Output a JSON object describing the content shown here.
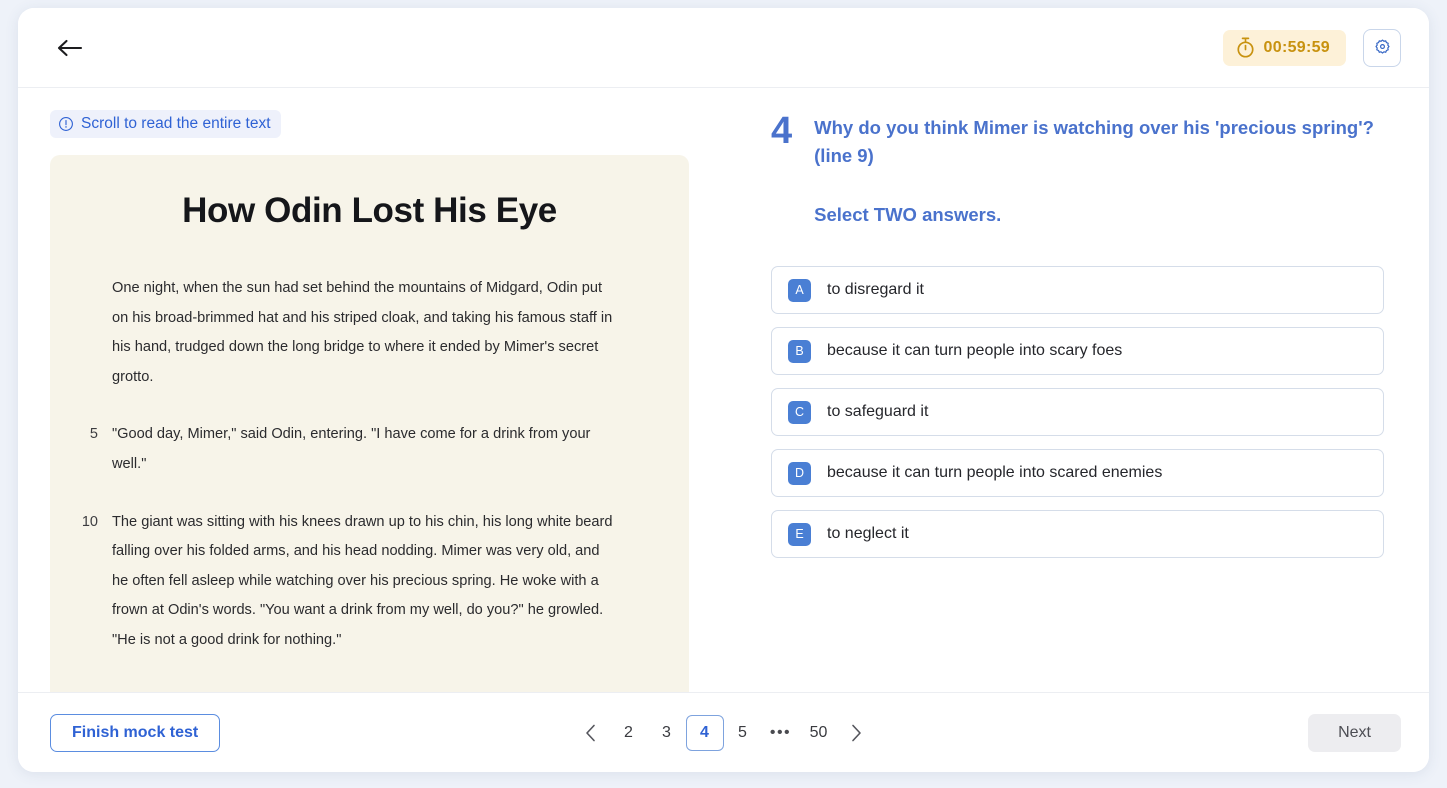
{
  "header": {
    "back_icon": "arrow-left-icon",
    "timer_icon": "stopwatch-icon",
    "timer": "00:59:59",
    "settings_icon": "gear-icon"
  },
  "passage": {
    "scroll_hint_icon": "info-circle-icon",
    "scroll_hint": "Scroll to read the entire text",
    "title": "How Odin Lost His Eye",
    "paragraphs": [
      {
        "lineno": "",
        "text": "One night, when the sun had set behind the mountains of Midgard, Odin put on his broad-brimmed hat and his striped cloak, and taking his famous staff in his hand, trudged down the long bridge to where it ended by Mimer's secret grotto."
      },
      {
        "lineno": "5",
        "text": "\"Good day, Mimer,\" said Odin, entering. \"I have come for a drink from your well.\""
      },
      {
        "lineno": "10",
        "text": "The giant was sitting with his knees drawn up to his chin, his long white beard falling over his folded arms, and his head nodding. Mimer was very old, and he often fell asleep while watching over his precious spring. He woke with a frown at Odin's words. \"You want a drink from my well, do you?\" he growled. \"Не is not a good drink for nothing.\""
      }
    ]
  },
  "question": {
    "number": "4",
    "text": "Why do you think Mimer is watching over his 'precious spring'? (line 9)",
    "instruction": "Select TWO answers.",
    "options": [
      {
        "badge": "A",
        "label": "to disregard it"
      },
      {
        "badge": "B",
        "label": "because it can turn people into scary foes"
      },
      {
        "badge": "C",
        "label": "to safeguard it"
      },
      {
        "badge": "D",
        "label": "because it can turn people into scared enemies"
      },
      {
        "badge": "E",
        "label": "to neglect it"
      }
    ]
  },
  "footer": {
    "finish_label": "Finish mock test",
    "next_label": "Next",
    "prev_arrow": "chevron-left-icon",
    "next_arrow": "chevron-right-icon",
    "pages": [
      "2",
      "3",
      "4",
      "5",
      "•••",
      "50"
    ],
    "active_page": "4"
  },
  "colors": {
    "accent_blue": "#4a72cc",
    "timer_amber": "#c8920f",
    "passage_bg": "#f7f4e9"
  }
}
